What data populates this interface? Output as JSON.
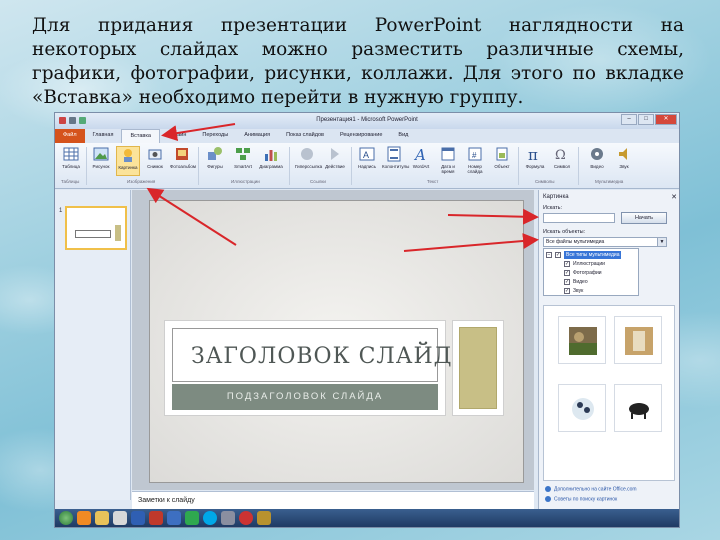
{
  "caption": "Для придания презентации PowerPoint наглядности на некоторых слайдах можно разместить различные схемы, графики, фотографии, рисунки, коллажи. Для этого по вкладке «Вставка» необходимо перейти в нужную группу.",
  "window": {
    "title": "Презентация1 - Microsoft PowerPoint",
    "minimize": "–",
    "maximize": "□",
    "close": "✕"
  },
  "tabs": [
    "Файл",
    "Главная",
    "Вставка",
    "Дизайн",
    "Переходы",
    "Анимация",
    "Показ слайдов",
    "Рецензирование",
    "Вид"
  ],
  "ribbon": {
    "buttons": [
      {
        "label": "Таблица",
        "icon": "table-icon"
      },
      {
        "label": "Рисунок",
        "icon": "picture-icon"
      },
      {
        "label": "Картинка",
        "icon": "clipart-icon"
      },
      {
        "label": "Снимок",
        "icon": "screenshot-icon"
      },
      {
        "label": "Фотоальбом",
        "icon": "photo-album-icon"
      },
      {
        "label": "Фигуры",
        "icon": "shapes-icon"
      },
      {
        "label": "SmartArt",
        "icon": "smartart-icon"
      },
      {
        "label": "Диаграмма",
        "icon": "chart-icon"
      },
      {
        "label": "Гиперссылка",
        "icon": "hyperlink-icon"
      },
      {
        "label": "Действие",
        "icon": "action-icon"
      },
      {
        "label": "Надпись",
        "icon": "textbox-icon"
      },
      {
        "label": "Колонтитулы",
        "icon": "header-footer-icon"
      },
      {
        "label": "WordArt",
        "icon": "wordart-icon"
      },
      {
        "label": "Дата и время",
        "icon": "date-time-icon"
      },
      {
        "label": "Номер слайда",
        "icon": "slide-number-icon"
      },
      {
        "label": "Объект",
        "icon": "object-icon"
      },
      {
        "label": "Формула",
        "icon": "formula-icon"
      },
      {
        "label": "Символ",
        "icon": "symbol-icon"
      },
      {
        "label": "Видео",
        "icon": "video-icon"
      },
      {
        "label": "Звук",
        "icon": "audio-icon"
      }
    ],
    "groups": [
      "Таблицы",
      "Изображения",
      "Иллюстрации",
      "Ссылки",
      "Текст",
      "Символы",
      "Мультимедиа"
    ]
  },
  "thumbs": {
    "number": "1"
  },
  "slide": {
    "title": "ЗАГОЛОВОК СЛАЙДА",
    "subtitle": "ПОДЗАГОЛОВОК СЛАЙДА"
  },
  "notes": "Заметки к слайду",
  "pane": {
    "title": "Картинка",
    "close": "✕",
    "search_label": "Искать:",
    "go_button": "Начать",
    "objects_label": "Искать объекты:",
    "objects_value": "Все файлы мультимедиа",
    "tree": [
      "Все типы мультимедиа",
      "Иллюстрации",
      "Фотографии",
      "Видео",
      "Звук"
    ],
    "link_more": "Дополнительно на сайте Office.com",
    "link_tips": "Советы по поиску картинок"
  },
  "colors": {
    "file_tab": "#d5531c",
    "selected_button": "#fbe39a",
    "arrow": "#d9262a",
    "slide_accent": "#c8bf86",
    "subtitle_bar": "#7d8b81"
  }
}
